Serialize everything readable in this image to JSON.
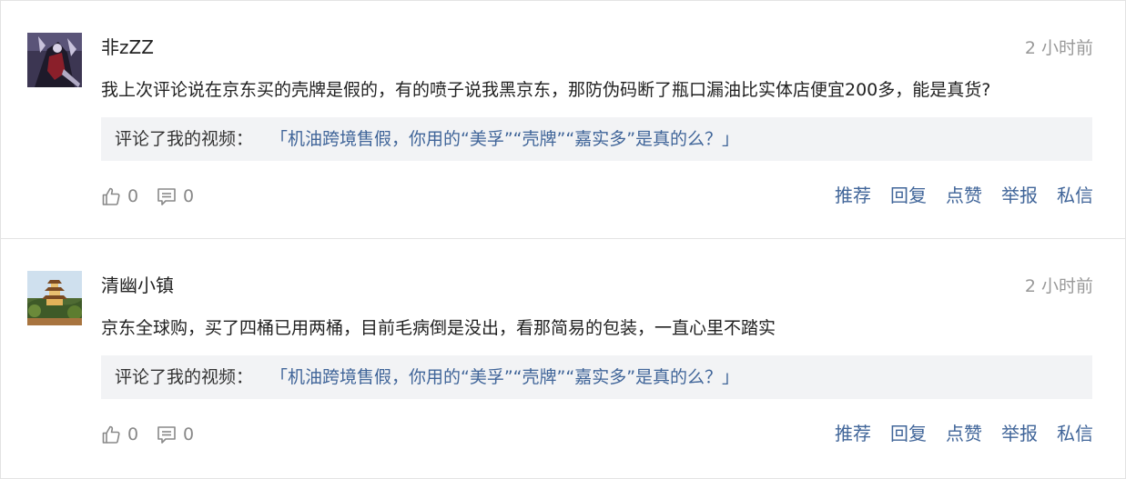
{
  "comments": [
    {
      "username": "非zZZ",
      "time": "2 小时前",
      "text": "我上次评论说在京东买的壳牌是假的，有的喷子说我黑京东，那防伪码断了瓶口漏油比实体店便宜200多，能是真货?",
      "quote_prefix": "评论了我的视频：",
      "quote_link": "「机油跨境售假，你用的“美孚”“壳牌”“嘉实多”是真的么？」",
      "likes": "0",
      "replies": "0",
      "avatar": "dark-purple-anime-avatar"
    },
    {
      "username": "清幽小镇",
      "time": "2 小时前",
      "text": "京东全球购，买了四桶已用两桶，目前毛病倒是没出，看那简易的包装，一直心里不踏实",
      "quote_prefix": "评论了我的视频：",
      "quote_link": "「机油跨境售假，你用的“美孚”“壳牌”“嘉实多”是真的么？」",
      "likes": "0",
      "replies": "0",
      "avatar": "pagoda-landscape-avatar"
    }
  ],
  "actions": {
    "recommend": "推荐",
    "reply": "回复",
    "like": "点赞",
    "report": "举报",
    "message": "私信"
  },
  "icons": {
    "like": "thumbs-up-icon",
    "reply": "comment-bubble-icon"
  },
  "colors": {
    "link": "#406599",
    "muted": "#999999",
    "quote_bg": "#f2f3f5"
  }
}
